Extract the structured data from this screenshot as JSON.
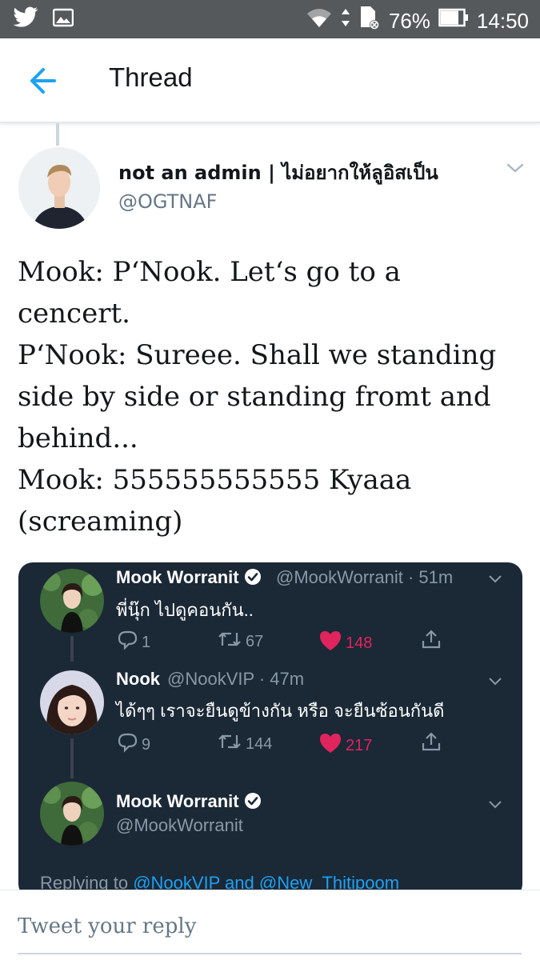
{
  "status_bar": {
    "battery": "76%",
    "time": "14:50",
    "icons": [
      "twitter-icon",
      "image-icon",
      "wifi-icon",
      "data-transfer-icon",
      "sim-icon",
      "battery-icon"
    ]
  },
  "header": {
    "title": "Thread",
    "back_icon": "arrow-left-icon"
  },
  "tweet": {
    "author_name": "not an admin | ไม่อยากให้ลูอิสเป็น",
    "author_handle": "@OGTNAF",
    "lines": [
      "Mook: P‘Nook. Let‘s go to a",
      "cencert.",
      "P‘Nook: Sureee. Shall we standing",
      "side by side or standing fromt and",
      "behind...",
      "Mook: 555555555555 Kyaaa",
      "(screaming)"
    ]
  },
  "embed": {
    "tweets": [
      {
        "name": "Mook Worranit",
        "verified": true,
        "handle": "@MookWorranit · 51m",
        "text": "พี่นุ๊ก ไปดูคอนกัน..",
        "replies": "1",
        "retweets": "67",
        "likes": "148"
      },
      {
        "name": "Nook",
        "verified": false,
        "handle": "@NookVIP · 47m",
        "text": "ได้ๆๆ เราจะยืนดูข้างกัน หรือ จะยืนซ้อนกันดี",
        "replies": "9",
        "retweets": "144",
        "likes": "217"
      },
      {
        "name": "Mook Worranit",
        "verified": true,
        "handle": "@MookWorranit"
      }
    ],
    "replying_prefix": "Replying to ",
    "replying_link": "@NookVIP and @New_Thitipoom"
  },
  "reply": {
    "placeholder": "Tweet your reply"
  },
  "colors": {
    "accent": "#1da1f2",
    "like": "#e0245e",
    "embed_bg": "#1b2836",
    "status_bar": "#56595c"
  }
}
